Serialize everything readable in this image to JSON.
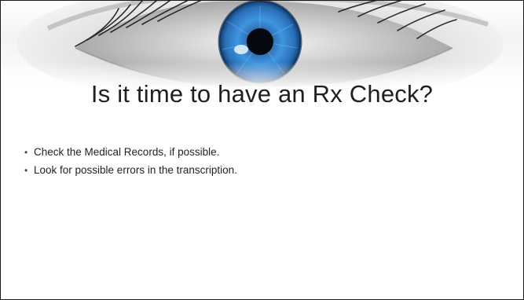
{
  "slide": {
    "title": "Is it time to have an Rx Check?",
    "bullets": [
      "Check the Medical Records, if possible.",
      "Look for possible errors in the transcription."
    ],
    "banner": {
      "image": "eye-closeup-icon",
      "iris_color": "#2f7fd3",
      "skin_tone": "#d8d8d8"
    }
  }
}
